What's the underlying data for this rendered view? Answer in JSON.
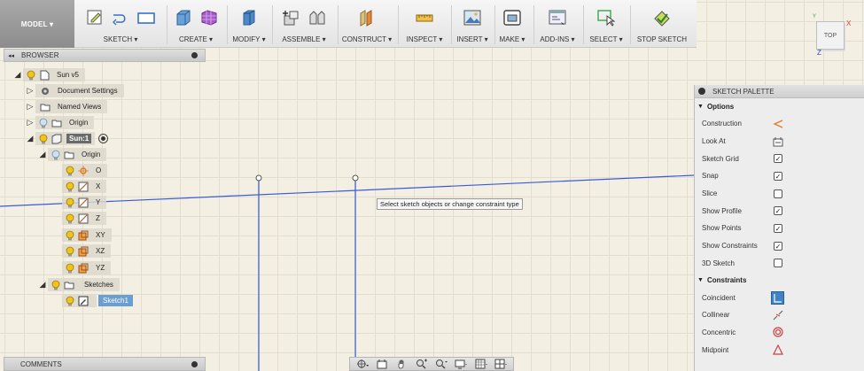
{
  "toolbar": {
    "model_label": "MODEL ▾",
    "groups": [
      {
        "label": "SKETCH ▾"
      },
      {
        "label": "CREATE ▾"
      },
      {
        "label": "MODIFY ▾"
      },
      {
        "label": "ASSEMBLE ▾"
      },
      {
        "label": "CONSTRUCT ▾"
      },
      {
        "label": "INSPECT ▾"
      },
      {
        "label": "INSERT ▾"
      },
      {
        "label": "MAKE ▾"
      },
      {
        "label": "ADD-INS ▾"
      },
      {
        "label": "SELECT ▾"
      },
      {
        "label": "STOP SKETCH"
      }
    ]
  },
  "browser": {
    "title": "BROWSER",
    "nodes": [
      {
        "label": "Sun v5",
        "icon": "document-icon"
      },
      {
        "label": "Document Settings",
        "icon": "gear-icon"
      },
      {
        "label": "Named Views",
        "icon": "folder-icon"
      },
      {
        "label": "Origin",
        "icon": "folder-icon"
      },
      {
        "label": "Sun:1",
        "icon": "component-icon"
      },
      {
        "label": "Origin",
        "icon": "folder-icon"
      },
      {
        "label": "O",
        "icon": "origin-point-icon"
      },
      {
        "label": "X",
        "icon": "axis-icon"
      },
      {
        "label": "Y",
        "icon": "axis-icon"
      },
      {
        "label": "Z",
        "icon": "axis-icon"
      },
      {
        "label": "XY",
        "icon": "plane-icon"
      },
      {
        "label": "XZ",
        "icon": "plane-icon"
      },
      {
        "label": "YZ",
        "icon": "plane-icon"
      },
      {
        "label": "Sketches",
        "icon": "folder-icon"
      },
      {
        "label": "Sketch1",
        "icon": "sketch-icon"
      }
    ]
  },
  "tooltip": "Select sketch objects or change constraint type",
  "viewcube": {
    "face": "TOP",
    "axis_x": "X",
    "axis_y": "Y",
    "axis_z": "Z"
  },
  "palette": {
    "title": "SKETCH PALETTE",
    "options_title": "Options",
    "options": [
      {
        "label": "Construction",
        "control": "construction-icon"
      },
      {
        "label": "Look At",
        "control": "look-at-icon"
      },
      {
        "label": "Sketch Grid",
        "checked": true
      },
      {
        "label": "Snap",
        "checked": true
      },
      {
        "label": "Slice",
        "checked": false
      },
      {
        "label": "Show Profile",
        "checked": true
      },
      {
        "label": "Show Points",
        "checked": true
      },
      {
        "label": "Show Constraints",
        "checked": true
      },
      {
        "label": "3D Sketch",
        "checked": false
      }
    ],
    "constraints_title": "Constraints",
    "constraints": [
      {
        "label": "Coincident",
        "icon": "coincident-icon"
      },
      {
        "label": "Collinear",
        "icon": "collinear-icon"
      },
      {
        "label": "Concentric",
        "icon": "concentric-icon"
      },
      {
        "label": "Midpoint",
        "icon": "midpoint-icon"
      }
    ]
  },
  "comments": {
    "title": "COMMENTS"
  },
  "colors": {
    "sketch_line": "#3b5bd6",
    "accent_orange": "#e07b20",
    "bulb": "#f0c419",
    "selection_blue": "#6a9ed0"
  }
}
